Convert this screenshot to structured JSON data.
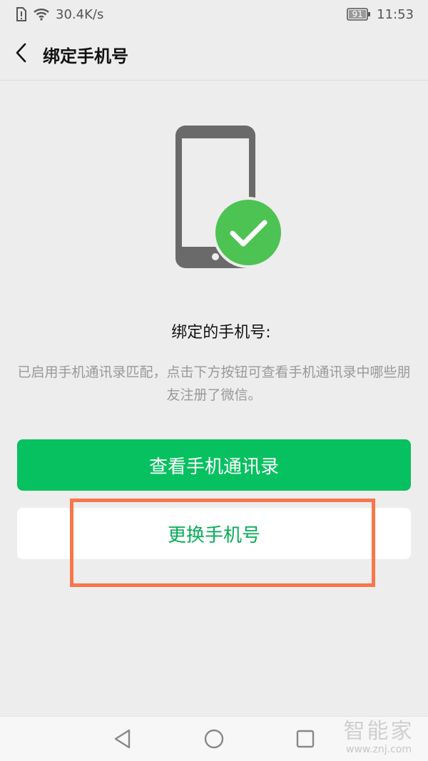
{
  "status_bar": {
    "net_speed": "30.4K/s",
    "battery": "91",
    "time": "11:53"
  },
  "header": {
    "title": "绑定手机号"
  },
  "main": {
    "bound_label": "绑定的手机号:",
    "description": "已启用手机通讯录匹配，点击下方按钮可查看手机通讯录中哪些朋友注册了微信。",
    "primary_button": "查看手机通讯录",
    "secondary_button": "更换手机号"
  },
  "watermark": {
    "name": "智能家",
    "url": "www.znj.com"
  },
  "colors": {
    "accent_green": "#07c160",
    "text_green": "#06ad56",
    "highlight_orange": "#f7774a",
    "background": "#ededed"
  }
}
